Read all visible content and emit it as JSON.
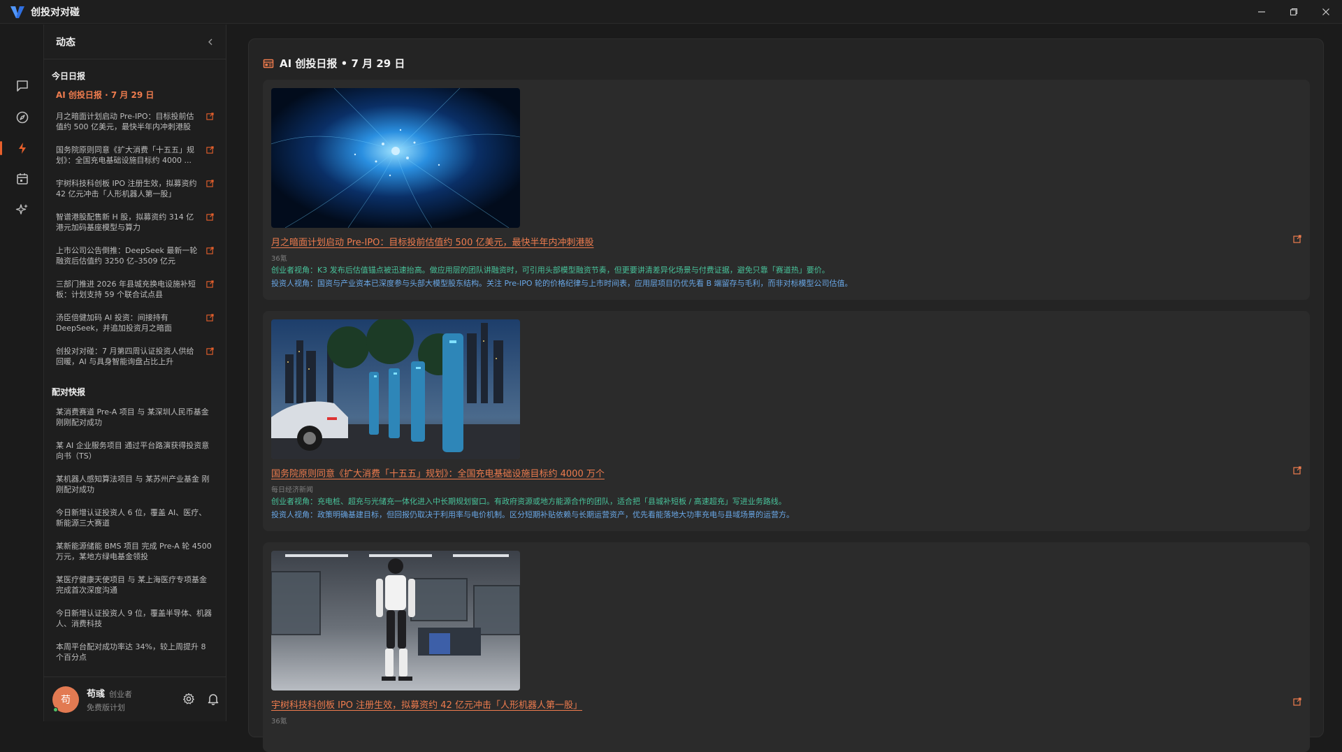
{
  "app": {
    "title": "创投对对碰",
    "accent": "#e8602c"
  },
  "rail": {
    "items": [
      {
        "icon": "chat-icon"
      },
      {
        "icon": "compass-icon"
      },
      {
        "icon": "lightning-icon",
        "active": true
      },
      {
        "icon": "calendar-icon"
      },
      {
        "icon": "sparkle-icon"
      }
    ]
  },
  "panel": {
    "title": "动态",
    "today_section": "今日日报",
    "daily_title": "AI 创投日报 · 7 月 29 日",
    "feed": [
      "月之暗面计划启动 Pre-IPO：目标投前估值约 500 亿美元，最快半年内冲刺港股",
      "国务院原则同意《扩大消费「十五五」规划》：全国充电基础设施目标约 4000 ...",
      "宇树科技科创板 IPO 注册生效，拟募资约 42 亿元冲击「人形机器人第一股」",
      "智谱港股配售新 H 股，拟募资约 314 亿港元加码基座模型与算力",
      "上市公司公告倒推：DeepSeek 最新一轮融资后估值约 3250 亿–3509 亿元",
      "三部门推进 2026 年县城充换电设施补短板：计划支持 59 个联合试点县",
      "汤臣倍健加码 AI 投资：间接持有 DeepSeek，并追加投资月之暗面",
      "创投对对碰：7 月第四周认证投资人供给回暖，AI 与具身智能询盘占比上升"
    ],
    "match_section": "配对快报",
    "matches": [
      "某消费赛道 Pre-A 项目 与 某深圳人民币基金 刚刚配对成功",
      "某 AI 企业服务项目 通过平台路演获得投资意向书（TS）",
      "某机器人感知算法项目 与 某苏州产业基金 刚刚配对成功",
      "今日新增认证投资人 6 位，覆盖 AI、医疗、新能源三大赛道",
      "某新能源储能 BMS 项目 完成 Pre-A 轮 4500 万元，某地方绿电基金领投",
      "某医疗健康天使项目 与 某上海医疗专项基金 完成首次深度沟通",
      "今日新增认证投资人 9 位，覆盖半导体、机器人、消费科技",
      "本周平台配对成功率达 34%，较上周提升 8 个百分点"
    ]
  },
  "user": {
    "avatar_text": "苟",
    "name": "苟彧",
    "role": "创业者",
    "plan": "免费版计划"
  },
  "main": {
    "title": "AI 创投日报 • 7 月 29 日",
    "cards": [
      {
        "title": "月之暗面计划启动 Pre-IPO：目标投前估值约 500 亿美元，最快半年内冲刺港股",
        "source": "36氪",
        "founder": "创业者视角：K3 发布后估值锚点被迅速抬高。做应用层的团队讲融资时，可引用头部模型融资节奏，但更要讲清差异化场景与付费证据，避免只靠「赛道热」要价。",
        "investor": "投资人视角：国资与产业资本已深度参与头部大模型股东结构。关注 Pre-IPO 轮的价格纪律与上市时间表，应用层项目仍优先看 B 端留存与毛利，而非对标模型公司估值。",
        "image": "ai-network-image"
      },
      {
        "title": "国务院原则同意《扩大消费「十五五」规划》：全国充电基础设施目标约 4000 万个",
        "source": "每日经济新闻",
        "founder": "创业者视角：充电桩、超充与光储充一体化进入中长期规划窗口。有政府资源或地方能源合作的团队，适合把「县城补短板 / 高速超充」写进业务路线。",
        "investor": "投资人视角：政策明确基建目标，但回报仍取决于利用率与电价机制。区分短期补贴依赖与长期运营资产，优先看能落地大功率充电与县域场景的运营方。",
        "image": "ev-charging-image"
      },
      {
        "title": "宇树科技科创板 IPO 注册生效，拟募资约 42 亿元冲击「人形机器人第一股」",
        "source": "36氪",
        "image": "humanoid-robot-image"
      }
    ]
  }
}
